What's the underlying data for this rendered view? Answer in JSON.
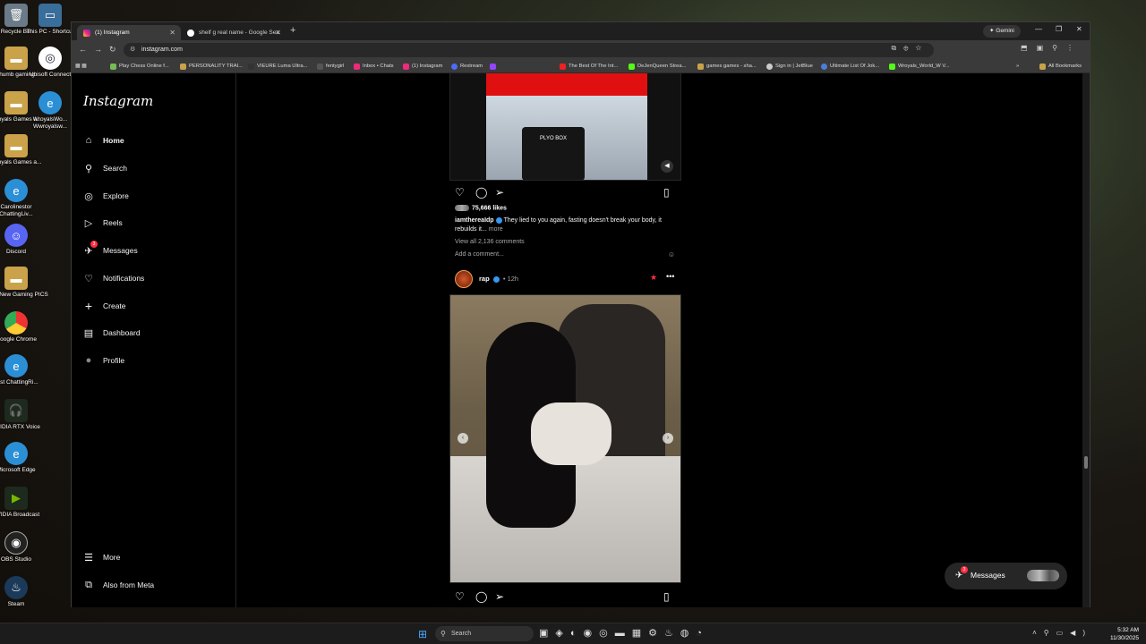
{
  "desktop": {
    "icons": [
      {
        "label": "Recycle Bin"
      },
      {
        "label": "This PC - Shortcut"
      },
      {
        "label": "thumb gaming"
      },
      {
        "label": "Ubisoft Connect"
      },
      {
        "label": "Wroyals Games a..."
      },
      {
        "label": "WroyalsWo... Wwroyalsw..."
      },
      {
        "label": "Wroyals Games a..."
      },
      {
        "label": "Carolinestor ChattingLiv..."
      },
      {
        "label": "Discord"
      },
      {
        "label": "Dans New Gaming PICS"
      },
      {
        "label": "Google Chrome"
      },
      {
        "label": "Just ChattingRi..."
      },
      {
        "label": "NVIDIA RTX Voice"
      },
      {
        "label": "Microsoft Edge"
      },
      {
        "label": "NVIDIA Broadcast"
      },
      {
        "label": "OBS Studio"
      },
      {
        "label": "Steam"
      }
    ]
  },
  "browser": {
    "tabs": [
      {
        "label": "(1) Instagram",
        "active": true
      },
      {
        "label": "shelf g real name - Google Sea",
        "active": false
      }
    ],
    "new_tab": "+",
    "gemini_label": "Gemini",
    "url": "instagram.com",
    "bookmarks": [
      "Play Chess Online f...",
      "PERSONALITY TRAI...",
      "VIEURE Luma Ultra...",
      "fentygirl",
      "Inbox • Chats",
      "(1) Instagram",
      "Restream",
      "The Best Of The Int...",
      "DeJenQueen Strea...",
      "games games - sha...",
      "Sign in | JetBlue",
      "Ultimate List Of Jok...",
      "Wroyals_World_W V...",
      "All Bookmarks"
    ]
  },
  "instagram": {
    "logo": "Instagram",
    "nav": [
      {
        "label": "Home",
        "icon": "home-icon",
        "glyph": "⌂"
      },
      {
        "label": "Search",
        "icon": "search-icon",
        "glyph": "⚲"
      },
      {
        "label": "Explore",
        "icon": "explore-icon",
        "glyph": "◎"
      },
      {
        "label": "Reels",
        "icon": "reels-icon",
        "glyph": "▷"
      },
      {
        "label": "Messages",
        "icon": "messages-icon",
        "glyph": "✈",
        "badge": "3"
      },
      {
        "label": "Notifications",
        "icon": "heart-icon",
        "glyph": "♡"
      },
      {
        "label": "Create",
        "icon": "plus-icon",
        "glyph": "+"
      },
      {
        "label": "Dashboard",
        "icon": "dashboard-icon",
        "glyph": "▤"
      },
      {
        "label": "Profile",
        "icon": "profile-avatar-icon",
        "glyph": "●"
      }
    ],
    "nav_more": "More",
    "nav_meta": "Also from Meta",
    "post1": {
      "box_text": "PLYO BOX",
      "likes": "75,666 likes",
      "username": "iamthereaIdp",
      "caption": "They lied to you again, fasting doesn't break your body, it rebuilds it...",
      "more": "more",
      "comments": "View all 2,136 comments",
      "add_comment": "Add a comment..."
    },
    "post2": {
      "username": "rap",
      "time": "• 12h"
    },
    "messages_pill": {
      "label": "Messages",
      "badge": "3"
    }
  },
  "taskbar": {
    "search": "Search",
    "time": "5:32 AM",
    "date": "11/30/2025"
  }
}
